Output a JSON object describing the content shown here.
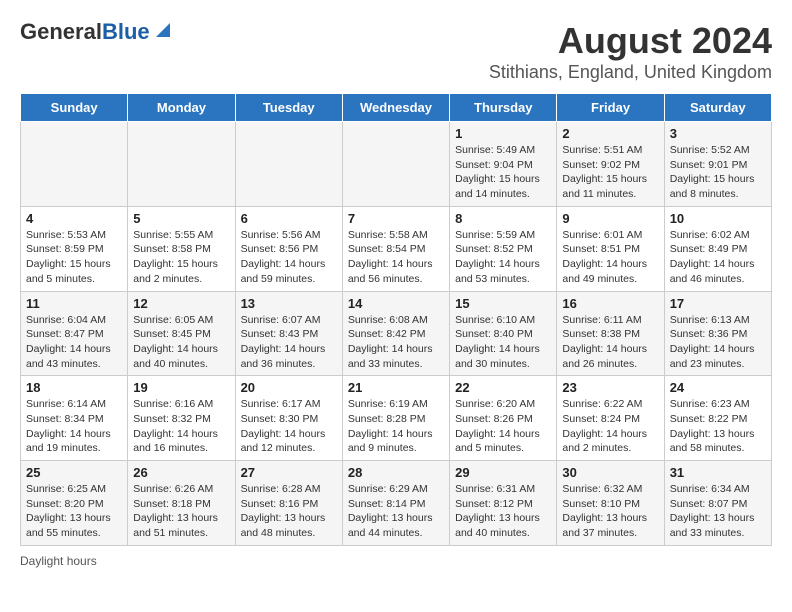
{
  "header": {
    "logo_line1": "General",
    "logo_line2": "Blue",
    "title": "August 2024",
    "subtitle": "Stithians, England, United Kingdom"
  },
  "days_of_week": [
    "Sunday",
    "Monday",
    "Tuesday",
    "Wednesday",
    "Thursday",
    "Friday",
    "Saturday"
  ],
  "weeks": [
    [
      {
        "day": "",
        "info": ""
      },
      {
        "day": "",
        "info": ""
      },
      {
        "day": "",
        "info": ""
      },
      {
        "day": "",
        "info": ""
      },
      {
        "day": "1",
        "info": "Sunrise: 5:49 AM\nSunset: 9:04 PM\nDaylight: 15 hours\nand 14 minutes."
      },
      {
        "day": "2",
        "info": "Sunrise: 5:51 AM\nSunset: 9:02 PM\nDaylight: 15 hours\nand 11 minutes."
      },
      {
        "day": "3",
        "info": "Sunrise: 5:52 AM\nSunset: 9:01 PM\nDaylight: 15 hours\nand 8 minutes."
      }
    ],
    [
      {
        "day": "4",
        "info": "Sunrise: 5:53 AM\nSunset: 8:59 PM\nDaylight: 15 hours\nand 5 minutes."
      },
      {
        "day": "5",
        "info": "Sunrise: 5:55 AM\nSunset: 8:58 PM\nDaylight: 15 hours\nand 2 minutes."
      },
      {
        "day": "6",
        "info": "Sunrise: 5:56 AM\nSunset: 8:56 PM\nDaylight: 14 hours\nand 59 minutes."
      },
      {
        "day": "7",
        "info": "Sunrise: 5:58 AM\nSunset: 8:54 PM\nDaylight: 14 hours\nand 56 minutes."
      },
      {
        "day": "8",
        "info": "Sunrise: 5:59 AM\nSunset: 8:52 PM\nDaylight: 14 hours\nand 53 minutes."
      },
      {
        "day": "9",
        "info": "Sunrise: 6:01 AM\nSunset: 8:51 PM\nDaylight: 14 hours\nand 49 minutes."
      },
      {
        "day": "10",
        "info": "Sunrise: 6:02 AM\nSunset: 8:49 PM\nDaylight: 14 hours\nand 46 minutes."
      }
    ],
    [
      {
        "day": "11",
        "info": "Sunrise: 6:04 AM\nSunset: 8:47 PM\nDaylight: 14 hours\nand 43 minutes."
      },
      {
        "day": "12",
        "info": "Sunrise: 6:05 AM\nSunset: 8:45 PM\nDaylight: 14 hours\nand 40 minutes."
      },
      {
        "day": "13",
        "info": "Sunrise: 6:07 AM\nSunset: 8:43 PM\nDaylight: 14 hours\nand 36 minutes."
      },
      {
        "day": "14",
        "info": "Sunrise: 6:08 AM\nSunset: 8:42 PM\nDaylight: 14 hours\nand 33 minutes."
      },
      {
        "day": "15",
        "info": "Sunrise: 6:10 AM\nSunset: 8:40 PM\nDaylight: 14 hours\nand 30 minutes."
      },
      {
        "day": "16",
        "info": "Sunrise: 6:11 AM\nSunset: 8:38 PM\nDaylight: 14 hours\nand 26 minutes."
      },
      {
        "day": "17",
        "info": "Sunrise: 6:13 AM\nSunset: 8:36 PM\nDaylight: 14 hours\nand 23 minutes."
      }
    ],
    [
      {
        "day": "18",
        "info": "Sunrise: 6:14 AM\nSunset: 8:34 PM\nDaylight: 14 hours\nand 19 minutes."
      },
      {
        "day": "19",
        "info": "Sunrise: 6:16 AM\nSunset: 8:32 PM\nDaylight: 14 hours\nand 16 minutes."
      },
      {
        "day": "20",
        "info": "Sunrise: 6:17 AM\nSunset: 8:30 PM\nDaylight: 14 hours\nand 12 minutes."
      },
      {
        "day": "21",
        "info": "Sunrise: 6:19 AM\nSunset: 8:28 PM\nDaylight: 14 hours\nand 9 minutes."
      },
      {
        "day": "22",
        "info": "Sunrise: 6:20 AM\nSunset: 8:26 PM\nDaylight: 14 hours\nand 5 minutes."
      },
      {
        "day": "23",
        "info": "Sunrise: 6:22 AM\nSunset: 8:24 PM\nDaylight: 14 hours\nand 2 minutes."
      },
      {
        "day": "24",
        "info": "Sunrise: 6:23 AM\nSunset: 8:22 PM\nDaylight: 13 hours\nand 58 minutes."
      }
    ],
    [
      {
        "day": "25",
        "info": "Sunrise: 6:25 AM\nSunset: 8:20 PM\nDaylight: 13 hours\nand 55 minutes."
      },
      {
        "day": "26",
        "info": "Sunrise: 6:26 AM\nSunset: 8:18 PM\nDaylight: 13 hours\nand 51 minutes."
      },
      {
        "day": "27",
        "info": "Sunrise: 6:28 AM\nSunset: 8:16 PM\nDaylight: 13 hours\nand 48 minutes."
      },
      {
        "day": "28",
        "info": "Sunrise: 6:29 AM\nSunset: 8:14 PM\nDaylight: 13 hours\nand 44 minutes."
      },
      {
        "day": "29",
        "info": "Sunrise: 6:31 AM\nSunset: 8:12 PM\nDaylight: 13 hours\nand 40 minutes."
      },
      {
        "day": "30",
        "info": "Sunrise: 6:32 AM\nSunset: 8:10 PM\nDaylight: 13 hours\nand 37 minutes."
      },
      {
        "day": "31",
        "info": "Sunrise: 6:34 AM\nSunset: 8:07 PM\nDaylight: 13 hours\nand 33 minutes."
      }
    ]
  ],
  "footer": {
    "daylight_label": "Daylight hours"
  }
}
